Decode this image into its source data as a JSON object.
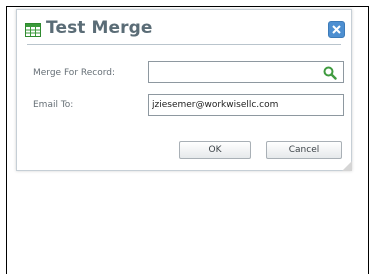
{
  "dialog": {
    "title": "Test Merge",
    "title_icon": "spreadsheet-icon",
    "close_icon": "close-icon"
  },
  "form": {
    "merge_label": "Merge For Record:",
    "merge_value": "",
    "merge_icon": "search-icon",
    "email_label": "Email To:",
    "email_value": "jziesemer@workwisellc.com"
  },
  "buttons": {
    "ok": "OK",
    "cancel": "Cancel"
  },
  "colors": {
    "title": "#5a6c76",
    "accent": "#4d8fd1",
    "search_icon": "#3f9b3f",
    "table_icon": "#3a9a3a"
  }
}
